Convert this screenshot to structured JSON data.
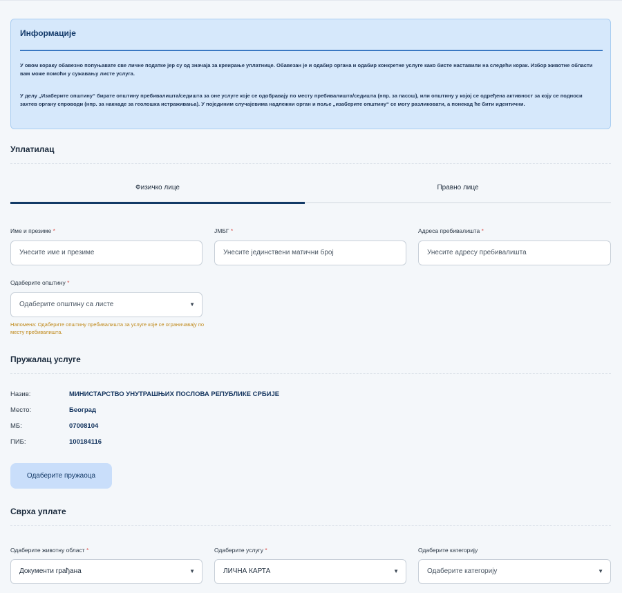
{
  "info": {
    "title": "Информације",
    "paragraph1": "У овом кораку обавезно попуњавате све личне податке јер су од значаја за креирање уплатнице. Обавезан је и одабир органа и одабир конкретне услуге како бисте наставили на следећи корак. Избор животне области вам може помоћи у сужавању листе услуга.",
    "paragraph2": "У делу „Изаберите општину“ бирате општину пребивалишта/седишта за оне услуге које се одобравају по месту пребивалишта/седишта (нпр. за пасош), или општину у којој се одређена активност за коју се подноси захтев органу спроводи (нпр. за накнаде за геолошка истраживања). У појединим случајевима надлежни орган и поље „изаберите општину“ се могу разликовати, а понекад ће бити идентични."
  },
  "payer": {
    "title": "Уплатилац",
    "tabs": [
      "Физичко лице",
      "Правно лице"
    ],
    "fields": {
      "name": {
        "label": "Име и презиме",
        "placeholder": "Унесите име и презиме"
      },
      "jmbg": {
        "label": "ЈМБГ",
        "placeholder": "Унесите јединствени матични број"
      },
      "address": {
        "label": "Адреса пребивалишта",
        "placeholder": "Унесите адресу пребивалишта"
      },
      "municipality": {
        "label": "Одаберите општину",
        "placeholder": "Одаберите општину са листе"
      }
    },
    "required_mark": "*",
    "note": "Напомена: Одаберите општину пребивалишта за услуге које се ограничавају по месту пребивалишта."
  },
  "provider": {
    "title": "Пружалац услуге",
    "rows": [
      {
        "key": "Назив:",
        "value": "МИНИСТАРСТВО УНУТРАШЊИХ ПОСЛОВА РЕПУБЛИКЕ СРБИЈЕ"
      },
      {
        "key": "Место:",
        "value": "Београд"
      },
      {
        "key": "МБ:",
        "value": "07008104"
      },
      {
        "key": "ПИБ:",
        "value": "100184116"
      }
    ],
    "button_label": "Одаберите пружаоца"
  },
  "purpose": {
    "title": "Сврха уплате",
    "fields": {
      "life_area": {
        "label": "Одаберите животну област",
        "value": "Документи грађана"
      },
      "service": {
        "label": "Одаберите услугу",
        "value": "ЛИЧНА КАРТА"
      },
      "category": {
        "label": "Одаберите категорију",
        "value": "Одаберите категорију"
      }
    }
  },
  "icons": {
    "dropdown": "chevron-down-icon"
  },
  "colors": {
    "accent": "#123a66",
    "info_bg": "#d6e8fb",
    "note": "#c08a1c",
    "required": "#d9534f"
  }
}
